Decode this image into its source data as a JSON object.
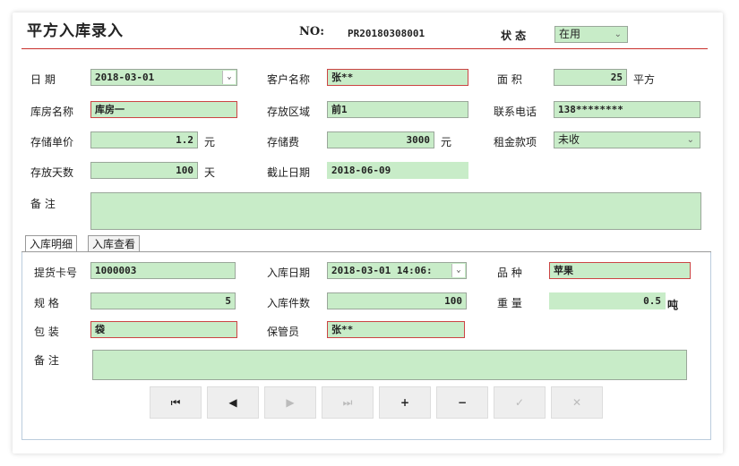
{
  "header": {
    "title": "平方入库录入",
    "no_label": "NO:",
    "no_value": "PR20180308001",
    "status_label": "状 态",
    "status_value": "在用"
  },
  "form": {
    "date_label": "日 期",
    "date_value": "2018-03-01",
    "customer_label": "客户名称",
    "customer_value": "张**",
    "area_label": "面 积",
    "area_value": "25",
    "area_unit": "平方",
    "warehouse_label": "库房名称",
    "warehouse_value": "库房一",
    "zone_label": "存放区域",
    "zone_value": "前1",
    "phone_label": "联系电话",
    "phone_value": "138********",
    "unit_price_label": "存储单价",
    "unit_price_value": "1.2",
    "unit_price_unit": "元",
    "storage_fee_label": "存储费",
    "storage_fee_value": "3000",
    "storage_fee_unit": "元",
    "rent_label": "租金款项",
    "rent_value": "未收",
    "days_label": "存放天数",
    "days_value": "100",
    "days_unit": "天",
    "end_date_label": "截止日期",
    "end_date_value": "2018-06-09",
    "remark_label": "备 注",
    "remark_value": ""
  },
  "tabs": [
    {
      "label": "入库明细"
    },
    {
      "label": "入库查看"
    }
  ],
  "detail": {
    "pickup_label": "提货卡号",
    "pickup_value": "1000003",
    "in_date_label": "入库日期",
    "in_date_value": "2018-03-01 14:06:",
    "variety_label": "品 种",
    "variety_value": "苹果",
    "spec_label": "规 格",
    "spec_value": "5",
    "qty_label": "入库件数",
    "qty_value": "100",
    "weight_label": "重 量",
    "weight_value": "0.5",
    "weight_unit": "吨",
    "pack_label": "包 装",
    "pack_value": "袋",
    "keeper_label": "保管员",
    "keeper_value": "张**",
    "remark_label": "备 注",
    "remark_value": ""
  },
  "nav": {
    "first": "⏮",
    "prev": "◀",
    "next": "▶",
    "last": "⏭",
    "add": "+",
    "remove": "−",
    "confirm": "✓",
    "cancel": "✕"
  }
}
